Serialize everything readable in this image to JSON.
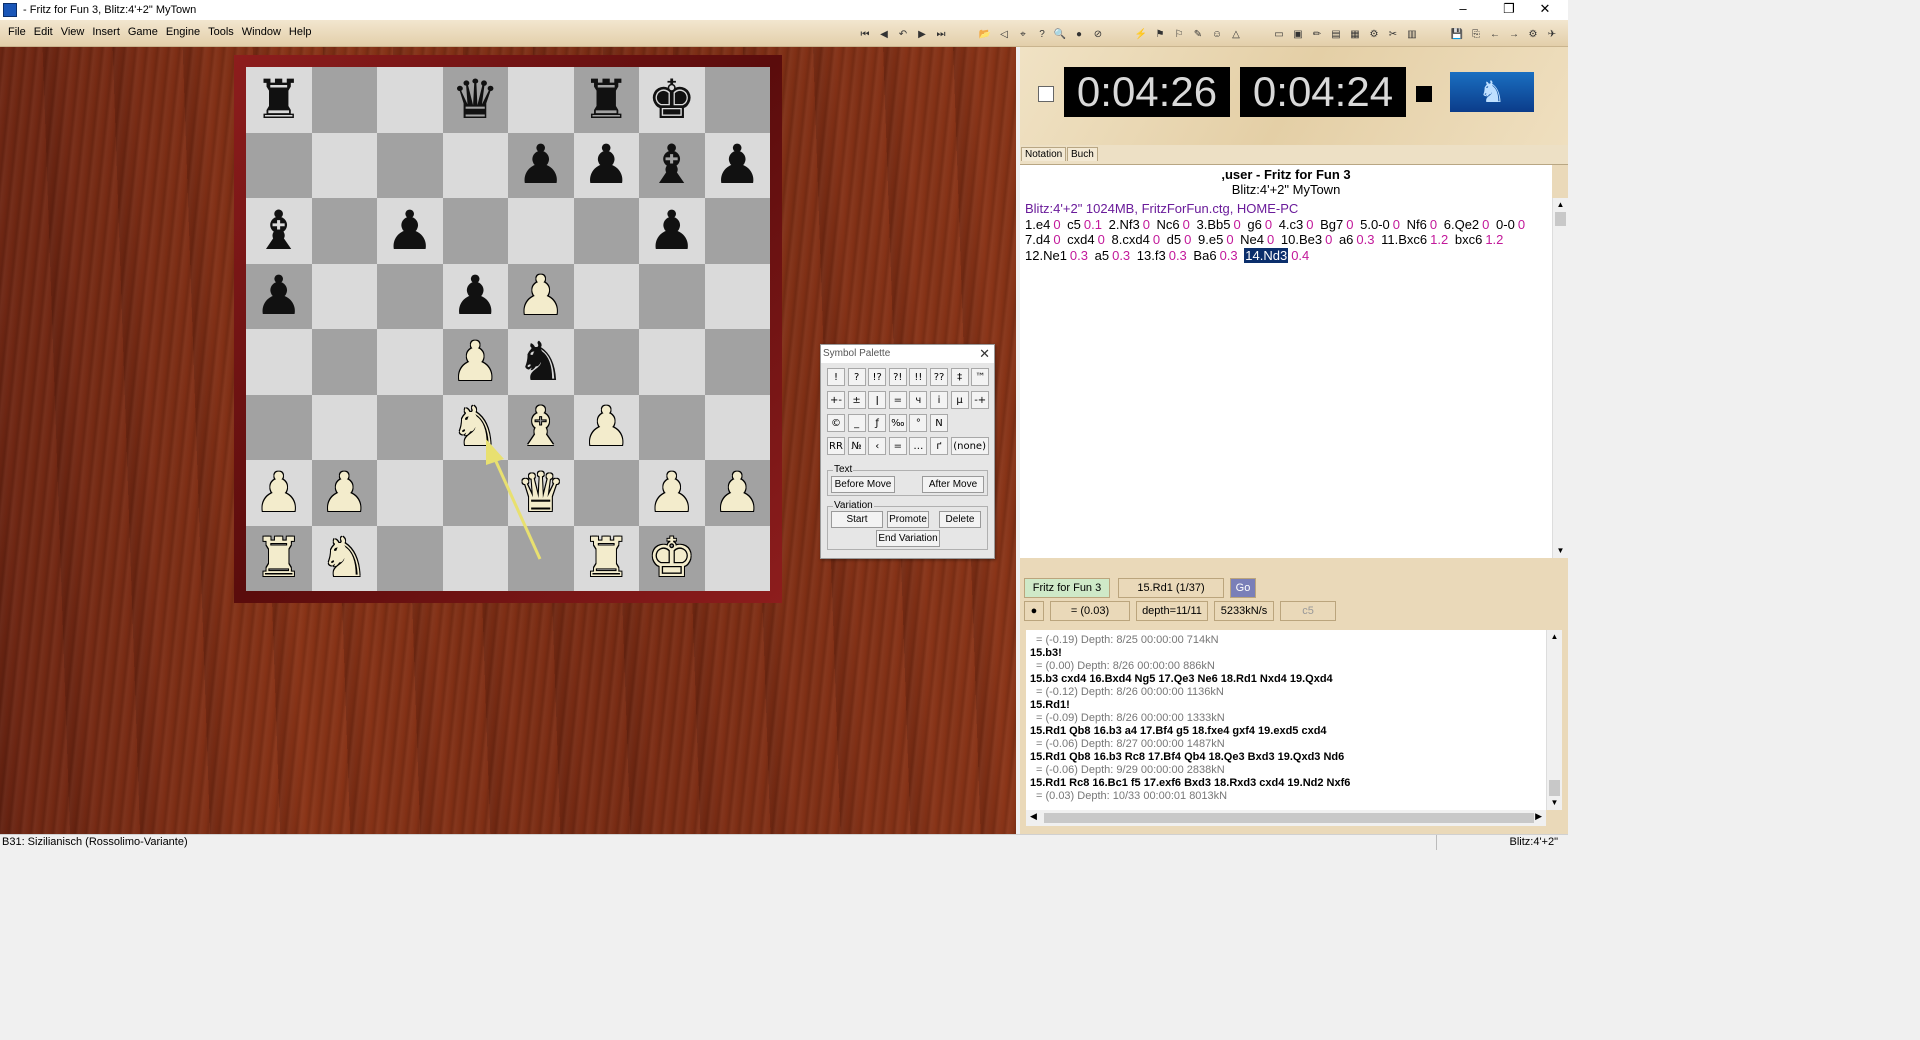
{
  "window": {
    "title": "- Fritz for Fun 3, Blitz:4'+2\" MyTown",
    "minimize": "–",
    "maximize": "❐",
    "close": "✕"
  },
  "menu": [
    "File",
    "Edit",
    "View",
    "Insert",
    "Game",
    "Engine",
    "Tools",
    "Window",
    "Help"
  ],
  "board": {
    "ranks": [
      [
        "r",
        "",
        "",
        "q",
        "",
        "r",
        "k",
        ""
      ],
      [
        "",
        "",
        "",
        "",
        "p",
        "p",
        "b",
        "p"
      ],
      [
        "b",
        "",
        "p",
        "",
        "",
        "",
        "p",
        ""
      ],
      [
        "p",
        "",
        "",
        "p",
        "P",
        "",
        "",
        ""
      ],
      [
        "",
        "",
        "",
        "P",
        "n",
        "",
        "",
        ""
      ],
      [
        "",
        "",
        "",
        "N",
        "B",
        "P",
        "",
        ""
      ],
      [
        "P",
        "P",
        "",
        "",
        "Q",
        "",
        "P",
        "P"
      ],
      [
        "R",
        "N",
        "",
        "",
        "",
        "R",
        "K",
        ""
      ]
    ],
    "glyphs": {
      "K": "♚",
      "Q": "♛",
      "R": "♜",
      "B": "♝",
      "N": "♞",
      "P": "♟",
      "k": "♚",
      "q": "♛",
      "r": "♜",
      "b": "♝",
      "n": "♞",
      "p": "♟"
    }
  },
  "clocks": {
    "white": "0:04:26",
    "black": "0:04:24"
  },
  "logo_icon": "knight-logo-icon",
  "tabs": [
    "Notation",
    "Buch"
  ],
  "notation": {
    "players": ",user - Fritz for Fun 3",
    "event": "Blitz:4'+2\" MyTown",
    "header": "Blitz:4'+2\"  1024MB, FritzForFun.ctg, HOME-PC",
    "moves": [
      {
        "m": "1.e4",
        "e": "0"
      },
      {
        "m": "c5",
        "e": "0.1"
      },
      {
        "m": "2.Nf3",
        "e": "0"
      },
      {
        "m": "Nc6",
        "e": "0"
      },
      {
        "m": "3.Bb5",
        "e": "0"
      },
      {
        "m": "g6",
        "e": "0"
      },
      {
        "m": "4.c3",
        "e": "0"
      },
      {
        "m": "Bg7",
        "e": "0"
      },
      {
        "m": "5.0-0",
        "e": "0"
      },
      {
        "m": "Nf6",
        "e": "0"
      },
      {
        "m": "6.Qe2",
        "e": "0"
      },
      {
        "m": "0-0",
        "e": "0"
      },
      {
        "m": "7.d4",
        "e": "0"
      },
      {
        "m": "cxd4",
        "e": "0"
      },
      {
        "m": "8.cxd4",
        "e": "0"
      },
      {
        "m": "d5",
        "e": "0"
      },
      {
        "m": "9.e5",
        "e": "0"
      },
      {
        "m": "Ne4",
        "e": "0"
      },
      {
        "m": "10.Be3",
        "e": "0"
      },
      {
        "m": "a6",
        "e": "0.3"
      },
      {
        "m": "11.Bxc6",
        "e": "1.2"
      },
      {
        "m": "bxc6",
        "e": "1.2"
      },
      {
        "m": "12.Ne1",
        "e": "0.3"
      },
      {
        "m": "a5",
        "e": "0.3"
      },
      {
        "m": "13.f3",
        "e": "0.3"
      },
      {
        "m": "Ba6",
        "e": "0.3"
      },
      {
        "m": "14.Nd3",
        "e": "0.4",
        "current": true
      }
    ]
  },
  "engine": {
    "name": "Fritz for Fun 3",
    "current_move": "15.Rd1 (1/37)",
    "go": "Go",
    "eval": "= (0.03)",
    "depth": "depth=11/11",
    "speed": "5233kN/s",
    "extra": "c5"
  },
  "analysis": [
    {
      "t": "s",
      "v": "= (-0.19)   Depth: 8/25   00:00:00  714kN"
    },
    {
      "t": "m",
      "v": "15.b3!"
    },
    {
      "t": "s",
      "v": "= (0.00)   Depth: 8/26   00:00:00  886kN"
    },
    {
      "t": "m",
      "v": "15.b3 cxd4 16.Bxd4 Ng5 17.Qe3 Ne6 18.Rd1 Nxd4 19.Qxd4"
    },
    {
      "t": "s",
      "v": "= (-0.12)   Depth: 8/26   00:00:00  1136kN"
    },
    {
      "t": "m",
      "v": "15.Rd1!"
    },
    {
      "t": "s",
      "v": "= (-0.09)   Depth: 8/26   00:00:00  1333kN"
    },
    {
      "t": "m",
      "v": "15.Rd1 Qb8 16.b3 a4 17.Bf4 g5 18.fxe4 gxf4 19.exd5 cxd4"
    },
    {
      "t": "s",
      "v": "= (-0.06)   Depth: 8/27   00:00:00  1487kN"
    },
    {
      "t": "m",
      "v": "15.Rd1 Qb8 16.b3 Rc8 17.Bf4 Qb4 18.Qe3 Bxd3 19.Qxd3 Nd6"
    },
    {
      "t": "s",
      "v": "= (-0.06)   Depth: 9/29   00:00:00  2838kN"
    },
    {
      "t": "m",
      "v": "15.Rd1 Rc8 16.Bc1 f5 17.exf6 Bxd3 18.Rxd3 cxd4 19.Nd2 Nxf6"
    },
    {
      "t": "s",
      "v": "= (0.03)   Depth: 10/33   00:00:01  8013kN"
    }
  ],
  "status": {
    "opening": "B31: Sizilianisch (Rossolimo-Variante)",
    "time_control": "Blitz:4'+2\""
  },
  "palette": {
    "title": "Symbol Palette",
    "rows": [
      [
        "!",
        "?",
        "!?",
        "?!",
        "!!",
        "??",
        "‡",
        "™"
      ],
      [
        "+-",
        "±",
        "ǀ",
        "=",
        "ч",
        "і",
        "µ",
        "-+"
      ],
      [
        "©",
        "_",
        "ƒ",
        "‰",
        "°",
        "N"
      ],
      [
        "RR",
        "№",
        "‹",
        "=",
        "…",
        "ґ",
        "(none)"
      ]
    ],
    "text_group": "Text",
    "before_move": "Before Move",
    "after_move": "After Move",
    "variation_group": "Variation",
    "start": "Start",
    "promote": "Promote",
    "delete": "Delete",
    "end_variation": "End Variation"
  },
  "colors": {
    "eval": "#c2189a",
    "header": "#6a1b9a",
    "current_move_bg": "#0b2f6c"
  }
}
